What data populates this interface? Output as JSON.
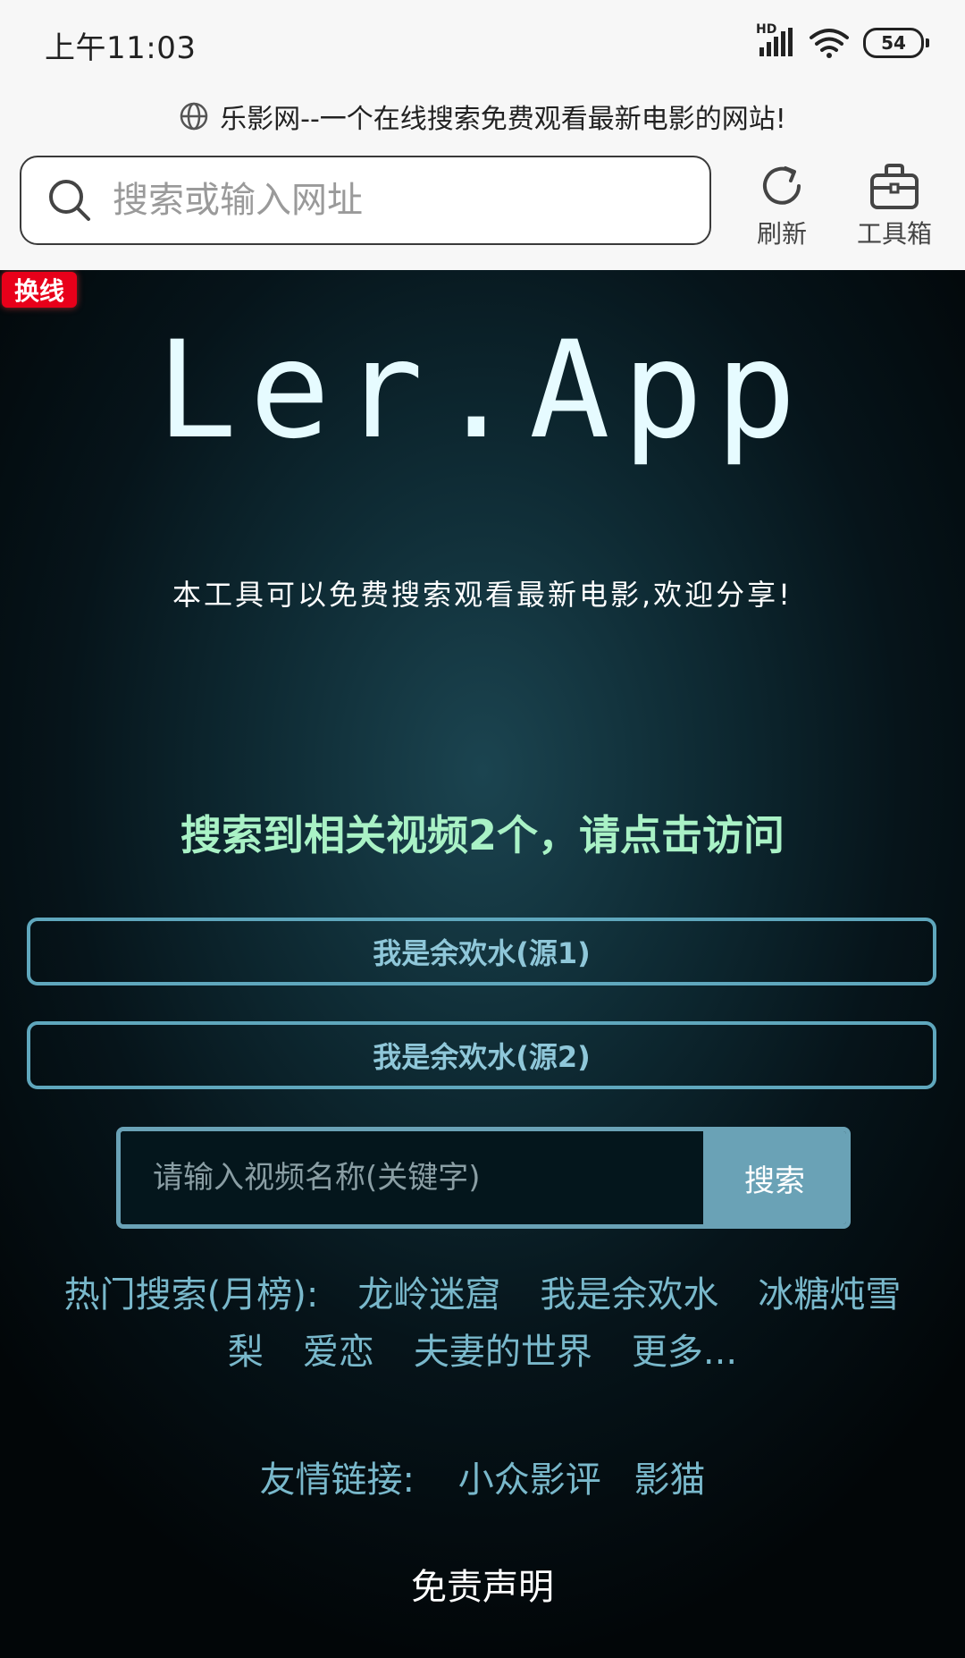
{
  "status_bar": {
    "time": "上午11:03",
    "network_label": "HD",
    "battery": "54"
  },
  "browser": {
    "page_title": "乐影网--一个在线搜索免费观看最新电影的网站!",
    "address_placeholder": "搜索或输入网址",
    "refresh_label": "刷新",
    "toolbox_label": "工具箱"
  },
  "page": {
    "switch_line_badge": "换线",
    "logo": "Ler.App",
    "tagline": "本工具可以免费搜索观看最新电影,欢迎分享!",
    "result_heading": "搜索到相关视频2个，请点击访问",
    "sources": [
      {
        "label": "我是余欢水(源1)"
      },
      {
        "label": "我是余欢水(源2)"
      }
    ],
    "search": {
      "placeholder": "请输入视频名称(关键字)",
      "button_label": "搜索"
    },
    "hot_search": {
      "label": "热门搜索(月榜):",
      "items": [
        "龙岭迷窟",
        "我是余欢水",
        "冰糖炖雪",
        "梨",
        "爱恋",
        "夫妻的世界",
        "更多..."
      ]
    },
    "friend_links": {
      "label": "友情链接:",
      "items": [
        "小众影评",
        "影猫"
      ]
    },
    "disclaimer": "免责声明"
  },
  "colors": {
    "accent": "#6aa2b6",
    "heading_green": "#a9f2c6",
    "badge_red": "#e8001a"
  }
}
